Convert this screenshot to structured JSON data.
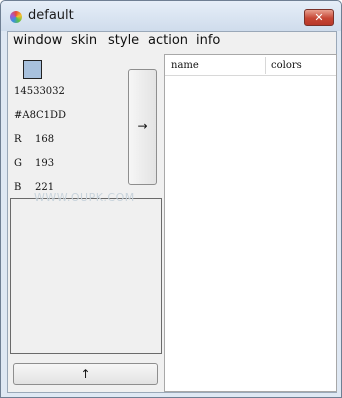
{
  "window": {
    "title": "default",
    "close_glyph": "✕",
    "icon": "color-wheel-icon"
  },
  "menu": {
    "items": [
      "window",
      "skin",
      "style",
      "action",
      "info"
    ]
  },
  "color": {
    "swatch_hex": "#A8C1DD",
    "decimal": "14533032",
    "hex_label": "#A8C1DD",
    "r_label": "R",
    "r_value": "168",
    "g_label": "G",
    "g_value": "193",
    "b_label": "B",
    "b_value": "221"
  },
  "buttons": {
    "add_arrow": "→",
    "up_arrow": "↑"
  },
  "table": {
    "columns": [
      "name",
      "colors"
    ]
  },
  "watermark": "WWW.OUPK.COM"
}
